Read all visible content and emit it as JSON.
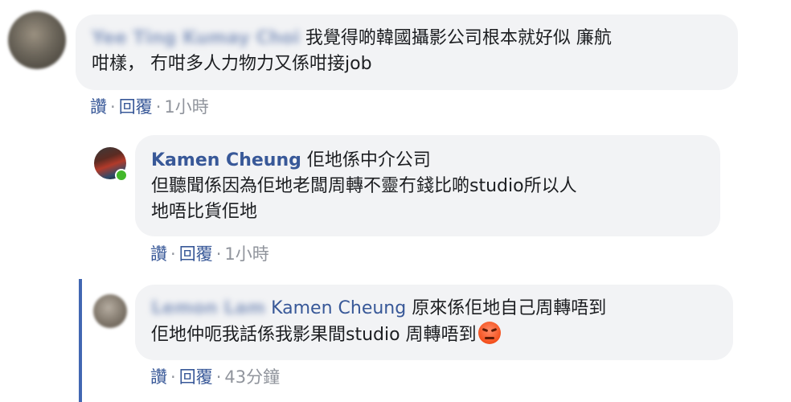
{
  "comments": [
    {
      "author": "Yee Ting Kumay Choi",
      "text_lines": [
        "我覺得啲韓國攝影公司根本就好似 廉航",
        "咁樣， 冇咁多人力物力又係咁接job"
      ],
      "like_label": "讚",
      "reply_label": "回覆",
      "time": "1小時"
    },
    {
      "author": "Kamen Cheung",
      "text_first": "佢地係中介公司",
      "text_lines": [
        "但聽聞係因為佢地老闆周轉不靈冇錢比啲studio所以人",
        "地唔比貨佢地"
      ],
      "like_label": "讚",
      "reply_label": "回覆",
      "time": "1小時"
    },
    {
      "author": "Lemon Lam",
      "mention": "Kamen Cheung",
      "text_first": "原來係佢地自己周轉唔到",
      "text_second": "佢地仲呃我話係我影果間studio 周轉唔到",
      "emoji": "angry-face-emoji",
      "like_label": "讚",
      "reply_label": "回覆",
      "time": "43分鐘"
    }
  ],
  "separator": "·"
}
